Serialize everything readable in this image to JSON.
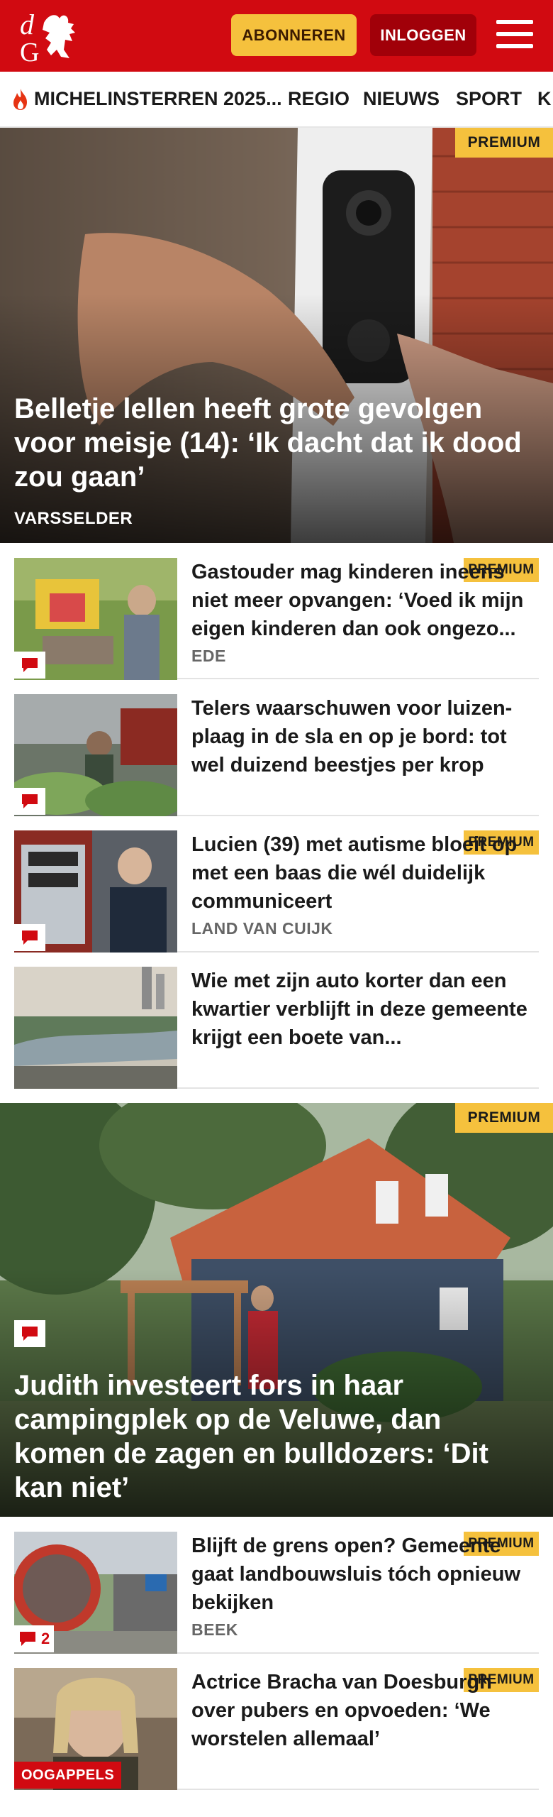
{
  "header": {
    "logo_text": "dG",
    "subscribe_label": "ABONNEREN",
    "login_label": "INLOGGEN",
    "colors": {
      "brand": "#d10a11",
      "subscribe": "#f5c13d",
      "login": "#a10009"
    }
  },
  "nav": {
    "items": [
      {
        "label": "MICHELINSTERREN 2025...",
        "icon": "flame-icon"
      },
      {
        "label": "REGIO"
      },
      {
        "label": "NIEUWS"
      },
      {
        "label": "SPORT"
      },
      {
        "label": "K"
      }
    ]
  },
  "hero1": {
    "badge": "PREMIUM",
    "title": "Belletje lellen heeft grote gevolgen voor meisje (14): ‘Ik dacht dat ik dood zou gaan’",
    "location": "VARSSELDER"
  },
  "items1": [
    {
      "badge": "PREMIUM",
      "title": "Gastouder mag kinderen ineens niet meer opvangen: ‘Voed ik mijn eigen kinderen dan ook ongezo...",
      "location": "EDE",
      "icon": "comment-icon"
    },
    {
      "badge": "",
      "title": "Telers waarschuwen voor luizen-plaag in de sla en op je bord: tot wel duizend beestjes per krop",
      "location": "",
      "icon": "comment-icon"
    },
    {
      "badge": "PREMIUM",
      "title": "Lucien (39) met autisme bloeit op met een baas die wél duidelijk communiceert",
      "location": "LAND VAN CUIJK",
      "icon": "comment-icon"
    },
    {
      "badge": "",
      "title": "Wie met zijn auto korter dan een kwartier verblijft in deze gemeente krijgt een boete van...",
      "location": ""
    }
  ],
  "hero2": {
    "badge": "PREMIUM",
    "title": "Judith investeert fors in haar campingplek op de Veluwe, dan komen de zagen en bulldozers: ‘Dit kan niet’",
    "icon": "comment-icon"
  },
  "items2": [
    {
      "badge": "PREMIUM",
      "title": "Blijft de grens open? Gemeente gaat landbouwsluis tóch opnieuw bekijken",
      "location": "BEEK",
      "comment_count": "2",
      "icon": "comment-icon"
    },
    {
      "badge": "PREMIUM",
      "title": "Actrice Bracha van Doesburgh over pubers en opvoeden: ‘We worstelen allemaal’",
      "location": "",
      "label": "OOGAPPELS"
    }
  ]
}
